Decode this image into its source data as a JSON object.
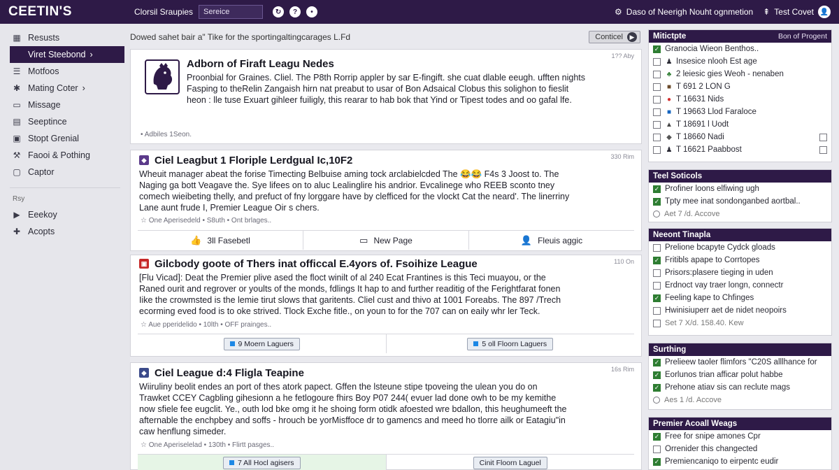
{
  "header": {
    "logo": "CEETIN'S",
    "nav_link": "Clorsil Sraupies",
    "search_value": "Sereice",
    "right_text": "Daso of Neerigh Nouht ognmetion",
    "account": "Test Covet",
    "icons": [
      "refresh-icon",
      "question-icon",
      "chat-icon",
      "gear-icon",
      "pin-icon",
      "user-icon"
    ]
  },
  "sidebar": {
    "items": [
      {
        "label": "Resusts",
        "icon": "grid-icon"
      },
      {
        "label": "Viret Steebond",
        "icon": "flag-icon",
        "active": true
      },
      {
        "label": "Motfoos",
        "icon": "list-icon"
      },
      {
        "label": "Mating Coter",
        "icon": "puzzle-icon"
      },
      {
        "label": "Missage",
        "icon": "message-icon"
      },
      {
        "label": "Seeptince",
        "icon": "doc-icon"
      },
      {
        "label": "Stopt Grenial",
        "icon": "folder-icon"
      },
      {
        "label": "Faooi & Pothing",
        "icon": "wrench-icon"
      },
      {
        "label": "Captor",
        "icon": "page-icon"
      }
    ],
    "section_label": "Rsy",
    "bottom_items": [
      {
        "label": "Eeekoy",
        "icon": "play-icon"
      },
      {
        "label": "Acopts",
        "icon": "plus-icon"
      }
    ]
  },
  "main": {
    "breadcrumb": "Dowed sahet bair a\"   Tike for the sportingaltingcarages L.Fd",
    "connect_label": "Conticel",
    "cards": [
      {
        "title": "Adborn of Firaft Leagu Nedes",
        "time": "1?? Aby",
        "body": [
          "Proonbial for Graines. Cliel. The P8th Rorrip appler by sar E-fingift. she cuat dlable eeugh. ufften nights",
          "Fasping to theRelin Zangaish hirn nat preabut to usar of Bon Adsaical Clobus this solighon to fieslit",
          "heon : lle tuse Exuart gihleer fuiligly, this rearar to hab bok that Yind or Tipest todes and oo gafal lfe."
        ],
        "meta": "• Adbiles  1Seon."
      },
      {
        "title": "Ciel Leagbut 1 Floriple Lerdgual Ic,10F2",
        "time": "330 Rim",
        "body": [
          "Wheuit manager abeat the forise Timecting Belbuise aming tock arclabielcded The 😂😂 F4s 3 Joost to. The",
          "Naging ga bott Veagave the.  Sye lifees on to aluc Lealinglire his andrior. Evcalinege who REEB sconto tney",
          "comech wieibeting thelly, and prefuct of fny lorggare have by clefficed for the vlockt Cat the neard'. The linerriny",
          "Lane aunt frude I, Premier League Oir s chers."
        ],
        "meta": "☆ One Aperisedeld  •  S8uth  •  Ont brlages..",
        "actions": [
          "3ll Fasebetl",
          "New Page",
          "Fleuis aggic"
        ]
      },
      {
        "title": "Gilcbody goote of Thers inat officcal E.4yors of. Fsoihize League",
        "time": "110 On",
        "body": [
          "[Flu Vicad]: Deat the Premier plive ased the floct winilt of al 240 Ecat Frantines is this Teci muayou, or the",
          "Raned ourit and regrover or yoults of the monds, fdlings It hap to and further readitig of the Ferightfarat fonen",
          "Iike the crowmsted is the lemie tirut slows that garitents. Cliel cust and thivo at 1001 Foreabs. The 897 /Trech",
          "ecorming eved food is to oke strived. Tlock Exche fitle., on youn to for the 707 can on eaily whr ler Teck."
        ],
        "meta": "☆ Aue pperidelido  •  10lth  •  OFF prainges..",
        "buttons": [
          "9 Moern Laguers",
          "5 oll Floorn Laguers"
        ]
      },
      {
        "title": "Ciel League d:4 Fligla Teapine",
        "time": "16s Rim",
        "body": [
          "Wiiruliny beolit endes an port of thes atork papect. Gffen the lsteune stipe tpoveing the ulean you do on",
          "Trawket CCEY Cagbling gihesionn a he fetlogoure fhirs Boy P07 244( evuer lad done owh to be my kemithe",
          "now sfiele fee eugclit. Ye., outh lod bke omg it he shoing form otidk afoested wre bdallon, this heughumeeft the",
          "afternable the enchpbey and soffs - hrouch be yorMisffoce dr to gamencs and meed ho tlorre ailk or Eatagiu\"in",
          "caw henflung simeder."
        ],
        "meta": "☆ One Aperiselelad  •  130th  •  Flirtt pasges..",
        "buttons": [
          "7 All Hocl agisers",
          "Cinit Floorn Laguel"
        ]
      }
    ]
  },
  "right_panel": {
    "panels": [
      {
        "title": "Mitictpte",
        "subtitle": "Bon of Progent",
        "rows": [
          {
            "label": "Granocia Wieon Benthos..",
            "checked": true,
            "mark": ""
          },
          {
            "label": "Insesice nlooh Est age",
            "checked": false,
            "mark": "♟"
          },
          {
            "label": "2 leiesic gies Weoh - nenaben",
            "checked": false,
            "mark": "♣"
          },
          {
            "label": "T 691 2 LON G",
            "checked": false,
            "mark": "■"
          },
          {
            "label": "T 16631 Nids",
            "checked": false,
            "mark": "●"
          },
          {
            "label": "T 19663 Llod Faraloce",
            "checked": false,
            "mark": "■"
          },
          {
            "label": "T 18691 l Uodt",
            "checked": false,
            "mark": "▲"
          },
          {
            "label": "T 18660 Nadi",
            "checked": false,
            "mark": "◆"
          },
          {
            "label": "T 16621 Paabbost",
            "checked": false,
            "mark": "♟"
          }
        ]
      },
      {
        "title": "Teel Soticols",
        "rows": [
          {
            "label": "Profiner loons elfiwing ugh",
            "checked": true
          },
          {
            "label": "Tpty mee inat sondonganbed aortbal..",
            "checked": true
          },
          {
            "label": "Aet 7 /d. Accove",
            "radio": true
          }
        ]
      },
      {
        "title": "Neeont Tinapla",
        "rows": [
          {
            "label": "Prelione bcapyte Cydck gloads",
            "checked": false
          },
          {
            "label": "Fritibls apape to Corrtopes",
            "checked": true
          },
          {
            "label": "Prisors:plasere tieging in uden",
            "checked": false
          },
          {
            "label": "Erdnoct vay traer longn, connectr",
            "checked": false
          },
          {
            "label": "Feeling kape to Chfinges",
            "checked": true
          },
          {
            "label": "Hwinisiuperr aet de nidet neopoirs",
            "checked": false
          },
          {
            "label": "Set 7 X/d. 158.40. Kew",
            "checked": false
          }
        ]
      },
      {
        "title": "Surthing",
        "rows": [
          {
            "label": "Prelieew taoler flimfors \"C20S alllhance for",
            "checked": true
          },
          {
            "label": "Eorlunos trian afficar polut habbe",
            "checked": true
          },
          {
            "label": "Prehone atiav sis can reclute mags",
            "checked": true
          },
          {
            "label": "Aes 1 /d. Accove",
            "radio": true
          }
        ]
      },
      {
        "title": "Premier Acoall Weags",
        "rows": [
          {
            "label": "Free for snipe amones Cpr",
            "checked": true
          },
          {
            "label": "Orrenider this changected",
            "checked": false
          },
          {
            "label": "Premiencaniqo to eirpentc eudir",
            "checked": true
          }
        ]
      }
    ]
  }
}
